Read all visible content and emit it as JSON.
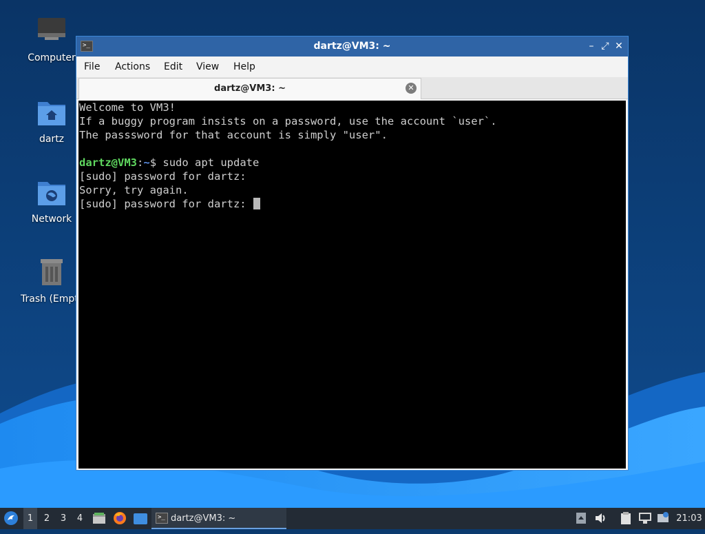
{
  "desktop": {
    "icons": [
      {
        "label": "Computer",
        "icon": "computer-icon"
      },
      {
        "label": "dartz",
        "icon": "home-folder-icon"
      },
      {
        "label": "Network",
        "icon": "network-folder-icon"
      },
      {
        "label": "Trash (Empty)",
        "icon": "trash-icon"
      }
    ]
  },
  "window": {
    "title": "dartz@VM3: ~",
    "buttons": {
      "minimize": "–",
      "maximize": "⤢",
      "close": "✕"
    },
    "menu": [
      "File",
      "Actions",
      "Edit",
      "View",
      "Help"
    ],
    "tab": {
      "label": "dartz@VM3: ~",
      "close": "✕"
    },
    "terminal": {
      "lines": [
        "Welcome to VM3!",
        "If a buggy program insists on a password, use the account `user`.",
        "The passsword for that account is simply \"user\".",
        "",
        "",
        "[sudo] password for dartz:",
        "Sorry, try again.",
        "[sudo] password for dartz: "
      ],
      "prompt": {
        "user_host": "dartz@VM3",
        "sep": ":",
        "path": "~",
        "dollar": "$ ",
        "command": "sudo apt update"
      }
    }
  },
  "taskbar": {
    "start_icon": "start-menu-icon",
    "workspaces": [
      "1",
      "2",
      "3",
      "4"
    ],
    "active_workspace": "1",
    "launchers": [
      "file-manager-icon",
      "firefox-icon",
      "show-desktop-icon"
    ],
    "task_label": "dartz@VM3: ~",
    "tray_icons": [
      "tray-arrow-icon",
      "volume-icon",
      "clipboard-icon",
      "network-icon",
      "update-notifier-icon"
    ],
    "clock": "21:03"
  },
  "colors": {
    "accent": "#2f64a6",
    "prompt_user": "#5fd75f",
    "prompt_path": "#5c8fe6",
    "terminal_bg": "#000000"
  }
}
